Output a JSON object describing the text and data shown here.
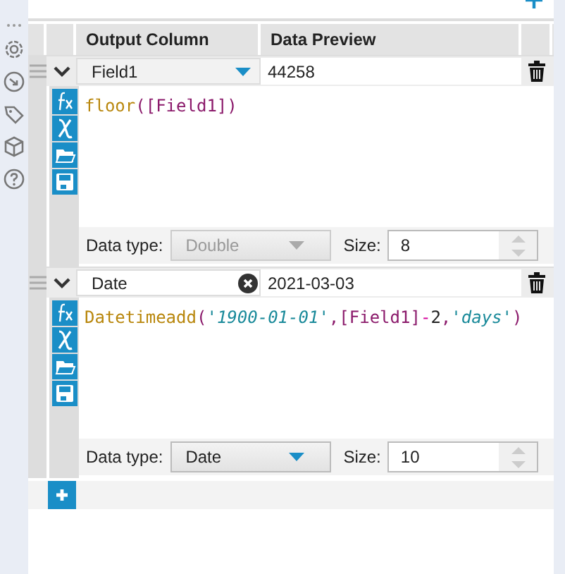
{
  "columns": [
    "Output Column",
    "Data Preview"
  ],
  "formulas": [
    {
      "output_field": {
        "kind": "select",
        "value": "Field1"
      },
      "preview": "44258",
      "expression": [
        {
          "text": "floor",
          "kind": "function"
        },
        {
          "text": "(",
          "kind": "bracket"
        },
        {
          "text": "[Field1]",
          "kind": "field"
        },
        {
          "text": ")",
          "kind": "bracket"
        }
      ],
      "data_type_label": "Data type:",
      "data_type": "Double",
      "data_type_disabled": true,
      "size_label": "Size:",
      "size": "8"
    },
    {
      "output_field": {
        "kind": "text",
        "value": "Date"
      },
      "preview": "2021-03-03",
      "expression": [
        {
          "text": "Datetimeadd",
          "kind": "function"
        },
        {
          "text": "(",
          "kind": "bracket"
        },
        {
          "text": "'1900-01-01'",
          "kind": "string"
        },
        {
          "text": ",",
          "kind": "bracket"
        },
        {
          "text": "[Field1]",
          "kind": "field"
        },
        {
          "text": "-",
          "kind": "operator"
        },
        {
          "text": "2",
          "kind": "number"
        },
        {
          "text": ",",
          "kind": "bracket"
        },
        {
          "text": "'days'",
          "kind": "string"
        },
        {
          "text": ")",
          "kind": "bracket"
        }
      ],
      "data_type_label": "Data type:",
      "data_type": "Date",
      "data_type_disabled": false,
      "size_label": "Size:",
      "size": "10"
    }
  ]
}
